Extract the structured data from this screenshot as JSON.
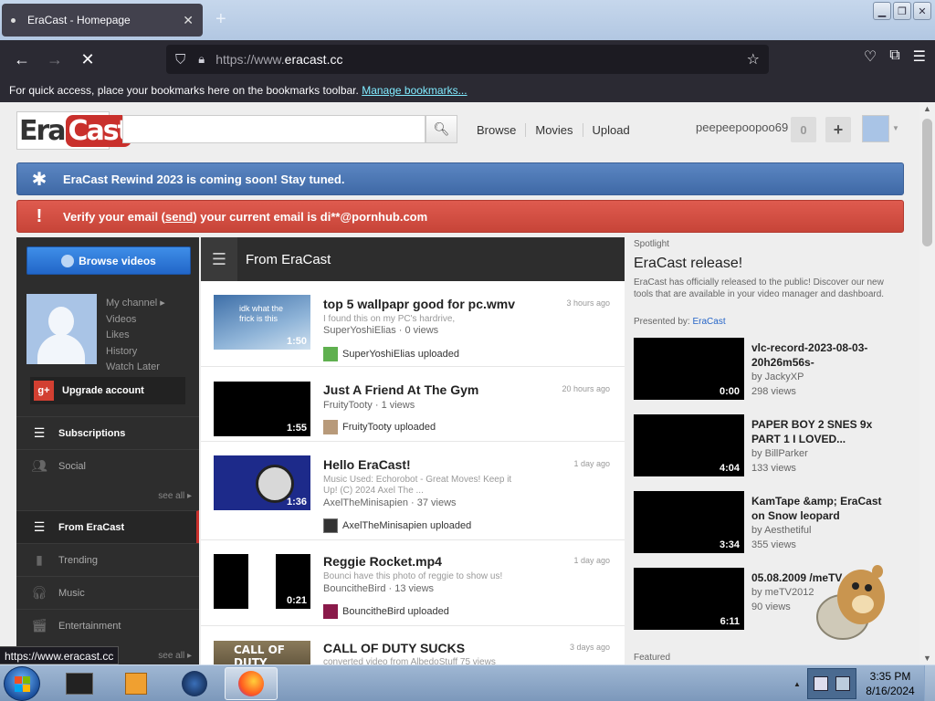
{
  "browser": {
    "tab_title": "EraCast - Homepage",
    "url_scheme": "https://www.",
    "url_host": "eracast.cc",
    "bookmarks_text": "For quick access, place your bookmarks here on the bookmarks toolbar.",
    "bookmarks_link": "Manage bookmarks...",
    "status_url": "https://www.eracast.cc"
  },
  "header": {
    "logo_era": "Era",
    "logo_cast": "Cast",
    "nav": [
      "Browse",
      "Movies",
      "Upload"
    ],
    "username": "peepeepoopoo69",
    "notifications": "0",
    "plus": "+"
  },
  "alerts": {
    "rewind": "EraCast Rewind 2023 is coming soon! Stay tuned.",
    "verify_pre": "Verify your email (",
    "verify_link": "send",
    "verify_post": ") your current email is di**@pornhub.com"
  },
  "sidebar": {
    "browse_button": "Browse videos",
    "channel_links": [
      "My channel ▸",
      "Videos",
      "Likes",
      "History",
      "Watch Later"
    ],
    "upgrade": "Upgrade account",
    "subscriptions": "Subscriptions",
    "social": "Social",
    "see_all": "see all ▸",
    "from_eracast": "From EraCast",
    "trending": "Trending",
    "music": "Music",
    "entertainment": "Entertainment",
    "see_all_2": "see all ▸"
  },
  "feed": {
    "title": "From EraCast",
    "items": [
      {
        "title": "top 5 wallpapr good for pc.wmv",
        "ago": "3 hours ago",
        "desc": "I found this on my PC's hardrive,",
        "meta": "SuperYoshiElias · 0 views",
        "uploader": "SuperYoshiElias uploaded",
        "duration": "1:50",
        "thumb_text": "idk what the frick is this"
      },
      {
        "title": "Just A Friend At The Gym",
        "ago": "20 hours ago",
        "desc": "",
        "meta": "FruityTooty · 1 views",
        "uploader": "FruityTooty uploaded",
        "duration": "1:55"
      },
      {
        "title": "Hello EraCast!",
        "ago": "1 day ago",
        "desc": "Music Used: Echorobot - Great Moves! Keep it Up! (C) 2024 Axel The ...",
        "meta": "AxelTheMinisapien · 37 views",
        "uploader": "AxelTheMinisapien uploaded",
        "duration": "1:36"
      },
      {
        "title": "Reggie Rocket.mp4",
        "ago": "1 day ago",
        "desc": "Bounci have this photo of reggie to show us!",
        "meta": "BouncitheBird · 13 views",
        "uploader": "BouncitheBird uploaded",
        "duration": "0:21"
      },
      {
        "title": "CALL OF DUTY SUCKS",
        "ago": "3 days ago",
        "desc": "",
        "meta": "",
        "uploader": "",
        "duration": "",
        "thumb_text": "CALL OF DUTY"
      }
    ],
    "cod_desc_partial": "converted video from AlbedoStuff 75 views"
  },
  "spotlight": {
    "label": "Spotlight",
    "title": "EraCast release!",
    "desc": "EraCast has officially released to the public! Discover our new tools that are available in your video manager and dashboard.",
    "by_prefix": "Presented by: ",
    "by_name": "EraCast",
    "recs": [
      {
        "title": "vlc-record-2023-08-03-20h26m56s-",
        "by": "by JackyXP",
        "views": "298 views",
        "duration": "0:00"
      },
      {
        "title": "PAPER BOY 2 SNES 9x PART 1 I LOVED...",
        "by": "by BillParker",
        "views": "133 views",
        "duration": "4:04"
      },
      {
        "title": "KamTape &amp; EraCast on Snow leopard",
        "by": "by Aesthetiful",
        "views": "355 views",
        "duration": "3:34"
      },
      {
        "title": "05.08.2009 /meTV",
        "by": "by meTV2012",
        "views": "90 views",
        "duration": "6:11"
      }
    ],
    "featured": "Featured"
  },
  "taskbar": {
    "time": "3:35 PM",
    "date": "8/16/2024"
  },
  "colors": {
    "alert_blue": "#4b79b8",
    "alert_red": "#d24f44",
    "browse_blue": "#2a74d8",
    "sidebar_dark": "#2d2d2d",
    "accent_red": "#c9302c"
  }
}
